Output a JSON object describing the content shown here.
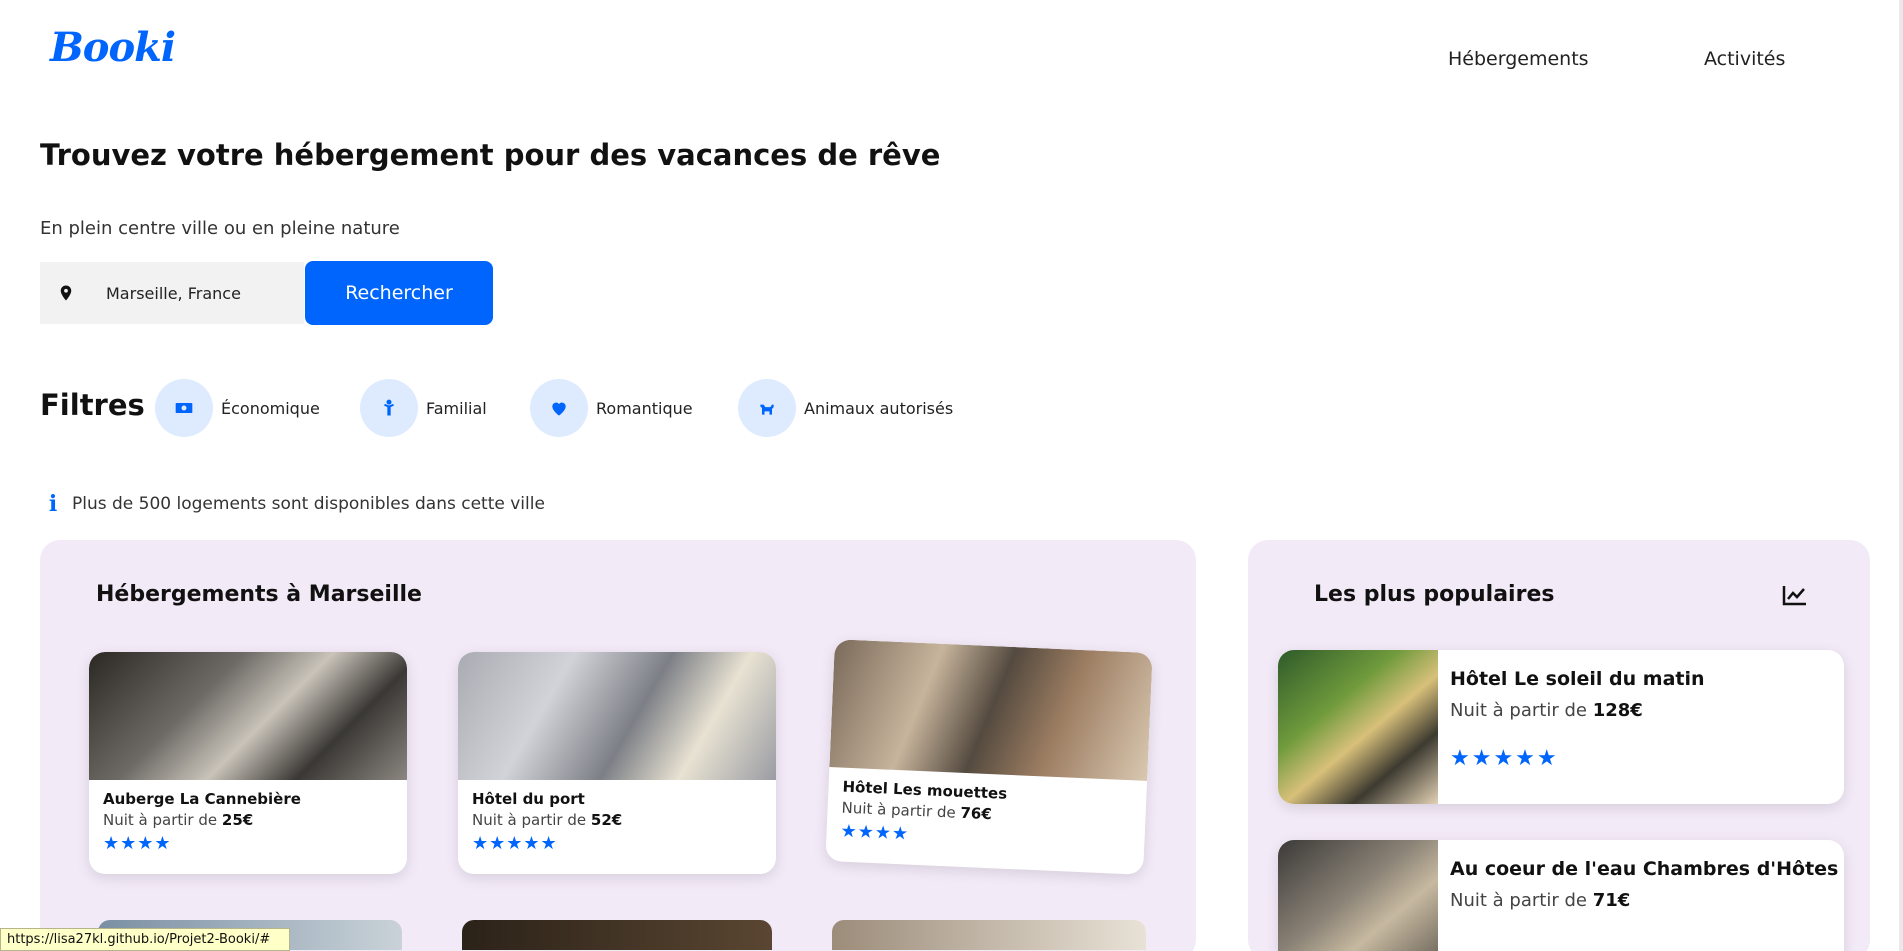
{
  "header": {
    "logo": "Booki",
    "nav": [
      "Hébergements",
      "Activités"
    ]
  },
  "hero": {
    "title": "Trouvez votre hébergement pour des vacances de rêve",
    "subtitle": "En plein centre ville ou en pleine nature",
    "search": {
      "value": "Marseille, France",
      "placeholder": "Marseille, France",
      "button_label": "Rechercher"
    }
  },
  "filters": {
    "title": "Filtres",
    "items": [
      {
        "label": "Économique",
        "icon": "money-icon"
      },
      {
        "label": "Familial",
        "icon": "child-icon"
      },
      {
        "label": "Romantique",
        "icon": "heart-icon"
      },
      {
        "label": "Animaux autorisés",
        "icon": "dog-icon"
      }
    ]
  },
  "info": {
    "text": "Plus de 500 logements sont disponibles dans cette ville"
  },
  "accommodations": {
    "title": "Hébergements à Marseille",
    "items": [
      {
        "name": "Auberge La Cannebière",
        "price_prefix": "Nuit à partir de",
        "price": "25€",
        "stars": "★★★★"
      },
      {
        "name": "Hôtel du port",
        "price_prefix": "Nuit à partir de",
        "price": "52€",
        "stars": "★★★★★"
      },
      {
        "name": "Hôtel Les mouettes",
        "price_prefix": "Nuit à partir de",
        "price": "76€",
        "stars": "★★★★"
      }
    ]
  },
  "popular": {
    "title": "Les plus populaires",
    "items": [
      {
        "name": "Hôtel Le soleil du matin",
        "price_prefix": "Nuit à partir de",
        "price": "128€",
        "stars": "★★★★★"
      },
      {
        "name": "Au coeur de l'eau Chambres d'Hôtes",
        "price_prefix": "Nuit à partir de",
        "price": "71€",
        "stars": ""
      }
    ]
  },
  "status_bar": {
    "url": "https://lisa27kl.github.io/Projet2-Booki/#"
  },
  "colors": {
    "primary": "#0065FC",
    "panel": "#F3EAF8",
    "filter_bubble": "#DEEBFF"
  }
}
